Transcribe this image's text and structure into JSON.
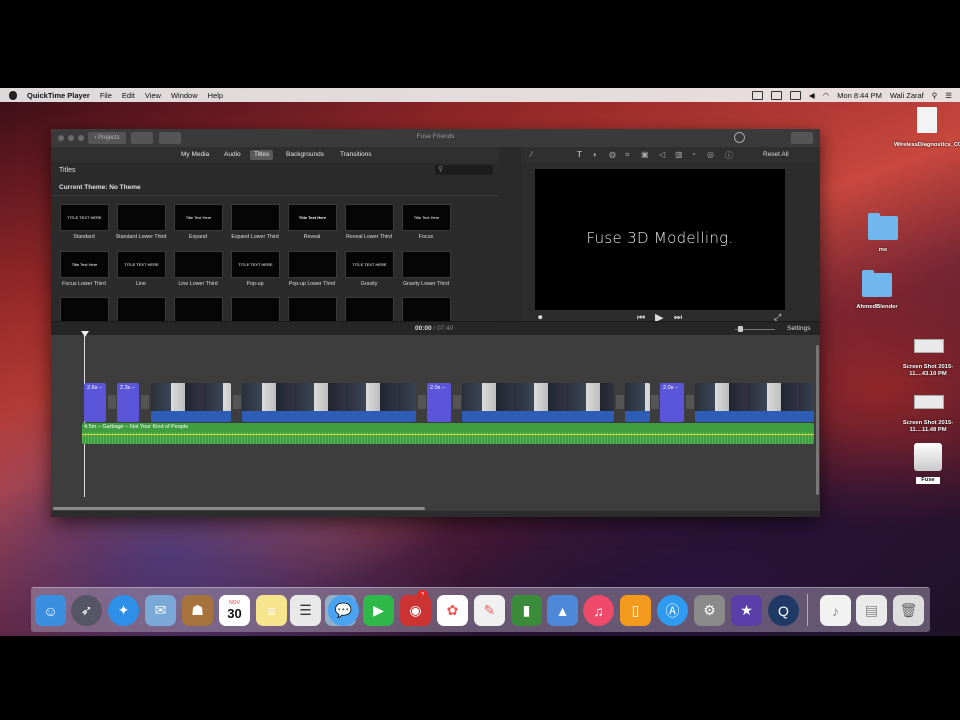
{
  "menubar": {
    "app_name": "QuickTime Player",
    "menus": [
      "File",
      "Edit",
      "View",
      "Window",
      "Help"
    ],
    "clock": "Mon 8:44 PM",
    "user": "Wali Zaraf"
  },
  "window": {
    "title": "Fuse Friends",
    "projects_button": "Projects",
    "tabs": [
      "My Media",
      "Audio",
      "Titles",
      "Backgrounds",
      "Transitions"
    ],
    "active_tab": "Titles",
    "reset_all": "Reset All"
  },
  "titles_browser": {
    "heading": "Titles",
    "theme": "Current Theme: No Theme",
    "items": [
      {
        "label": "Standard",
        "preview": "TITLE TEXT HERE"
      },
      {
        "label": "Standard Lower Third",
        "preview": ""
      },
      {
        "label": "Expand",
        "preview": "Title Text Here"
      },
      {
        "label": "Expand Lower Third",
        "preview": ""
      },
      {
        "label": "Reveal",
        "preview": "Title Text Here"
      },
      {
        "label": "Reveal Lower Third",
        "preview": ""
      },
      {
        "label": "Focus",
        "preview": "Title Text Here"
      },
      {
        "label": "Focus Lower Third",
        "preview": "Title Text Here"
      },
      {
        "label": "Line",
        "preview": "TITLE TEXT HERE"
      },
      {
        "label": "Line Lower Third",
        "preview": ""
      },
      {
        "label": "Pop-up",
        "preview": "TITLE TEXT HERE"
      },
      {
        "label": "Pop-up Lower Third",
        "preview": ""
      },
      {
        "label": "Gravity",
        "preview": "TITLE TEXT HERE"
      },
      {
        "label": "Gravity Lower Third",
        "preview": ""
      }
    ]
  },
  "viewer": {
    "text": "Fuse 3D Modelling."
  },
  "timeline": {
    "current_time": "00:00",
    "separator": "/",
    "total_time": "07:40",
    "settings": "Settings",
    "clips": [
      {
        "kind": "title",
        "label": "2.6s –"
      },
      {
        "kind": "title",
        "label": "2.3s –"
      },
      {
        "kind": "video",
        "label": ""
      },
      {
        "kind": "video",
        "label": ""
      },
      {
        "kind": "title",
        "label": "2.0s –"
      },
      {
        "kind": "video",
        "label": ""
      },
      {
        "kind": "video",
        "label": ""
      },
      {
        "kind": "title",
        "label": "2.0s –"
      },
      {
        "kind": "video",
        "label": ""
      }
    ],
    "audio_label": "4.5m – Garbage – Not Your Kind of People"
  },
  "desktop": {
    "icons": [
      {
        "label": "WirelessDiagnostics_C02H....2.tar.gz",
        "kind": "file"
      },
      {
        "label": "me",
        "kind": "folder"
      },
      {
        "label": "AhmedBlender",
        "kind": "folder"
      },
      {
        "label": "Screen Shot 2015-11....43.10 PM",
        "kind": "screenshot"
      },
      {
        "label": "Screen Shot 2015-11....11.48 PM",
        "kind": "screenshot"
      },
      {
        "label": "Fuse",
        "kind": "drive"
      }
    ]
  },
  "dock": {
    "calendar_month": "NOV",
    "calendar_day": "30",
    "facetime_badge": "2"
  }
}
